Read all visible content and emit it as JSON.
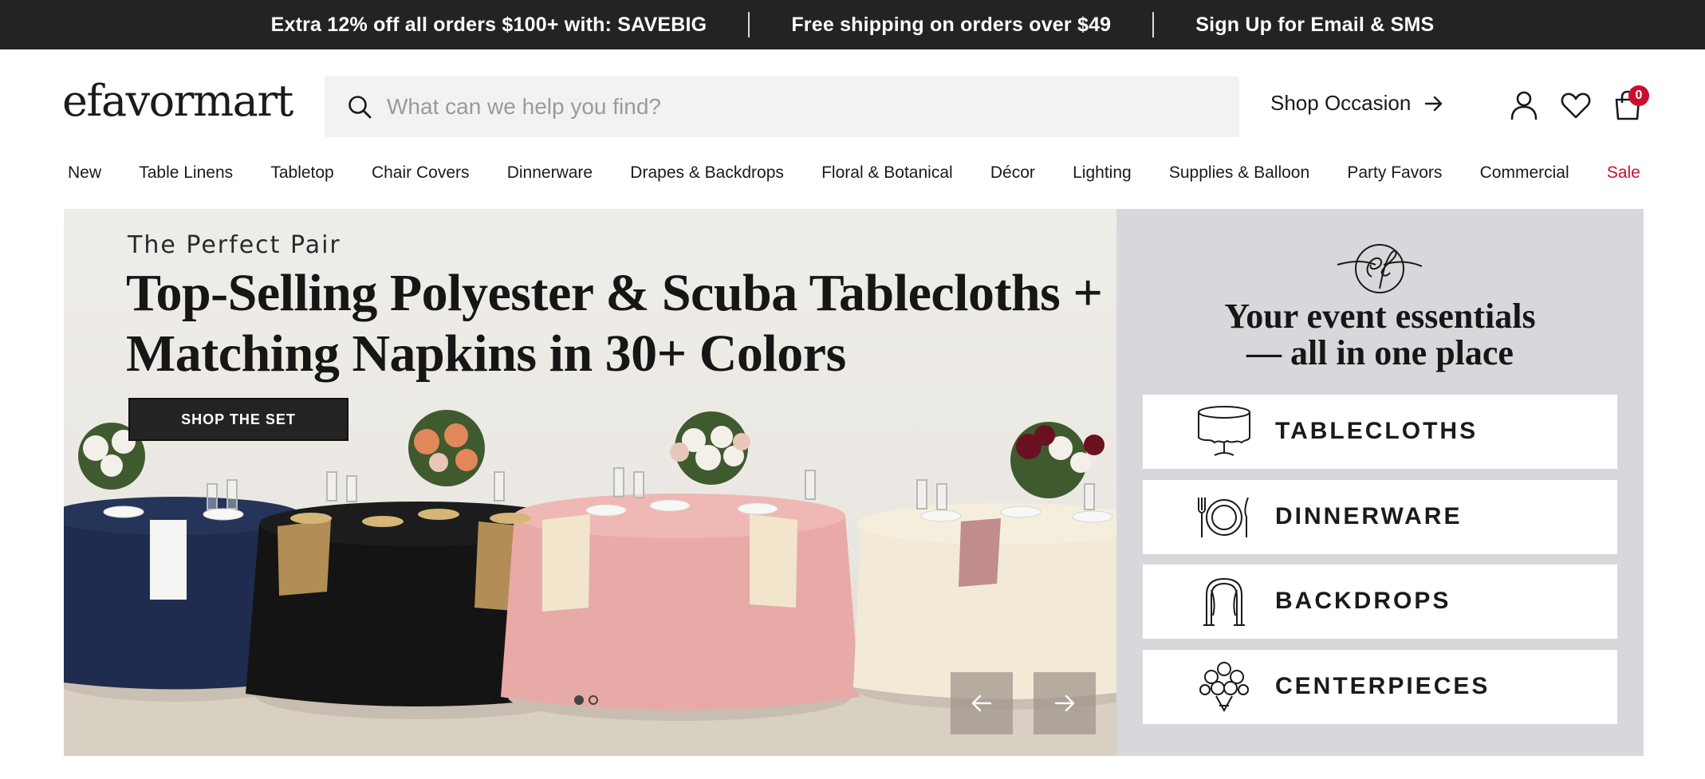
{
  "promo_bar": {
    "items": [
      "Extra 12% off all orders $100+ with: SAVEBIG",
      "Free shipping on orders over $49",
      "Sign Up for Email & SMS"
    ]
  },
  "header": {
    "logo": "efavormart",
    "search": {
      "placeholder": "What can we help you find?",
      "value": ""
    },
    "shop_occasion": "Shop Occasion",
    "cart_count": "0",
    "icons": [
      "search-icon",
      "arrow-right-icon",
      "account-icon",
      "heart-icon",
      "cart-icon"
    ]
  },
  "nav": {
    "items": [
      "New",
      "Table Linens",
      "Tabletop",
      "Chair Covers",
      "Dinnerware",
      "Drapes & Backdrops",
      "Floral & Botanical",
      "Décor",
      "Lighting",
      "Supplies & Balloon",
      "Party Favors",
      "Commercial",
      "Sale"
    ]
  },
  "hero": {
    "eyebrow": "The Perfect Pair",
    "title": "Top-Selling Polyester & Scuba Tablecloths + Matching Napkins in 30+ Colors",
    "cta": "SHOP THE SET",
    "slide_count": 2,
    "active_slide": 1
  },
  "essentials": {
    "heading_line1": "Your event essentials",
    "heading_line2": "— all in one place",
    "items": [
      {
        "label": "TABLECLOTHS",
        "icon": "tablecloth-icon"
      },
      {
        "label": "DINNERWARE",
        "icon": "dinnerware-icon"
      },
      {
        "label": "BACKDROPS",
        "icon": "backdrop-arch-icon"
      },
      {
        "label": "CENTERPIECES",
        "icon": "flower-bouquet-icon"
      }
    ]
  },
  "colors": {
    "promo_bg": "#232323",
    "sale_red": "#c8102e",
    "panel_bg": "#d7d8db",
    "search_bg": "#f2f2f3"
  }
}
